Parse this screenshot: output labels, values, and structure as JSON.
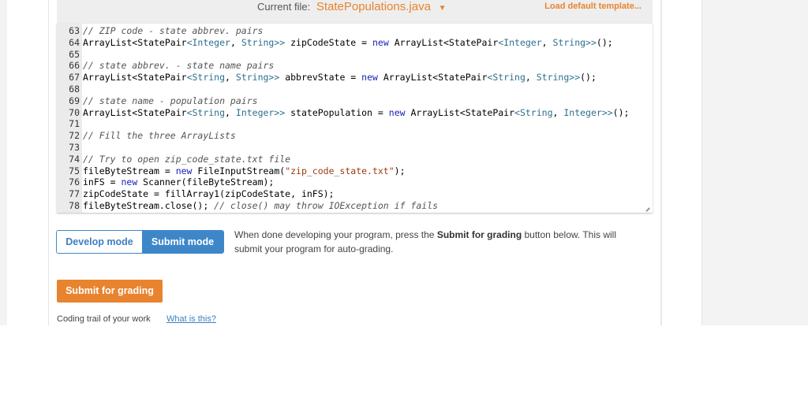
{
  "toolbar": {
    "current_file_label": "Current file:",
    "current_file_name": "StatePopulations.java",
    "load_default_template": "Load default template..."
  },
  "editor": {
    "lines": [
      {
        "n": "63",
        "parts": [
          {
            "t": "// ZIP code - state abbrev. pairs",
            "c": "cm"
          }
        ]
      },
      {
        "n": "64",
        "parts": [
          {
            "t": "ArrayList<StatePair",
            "c": "code"
          },
          {
            "t": "<Integer",
            "c": "ty"
          },
          {
            "t": ", ",
            "c": "code"
          },
          {
            "t": "String>>",
            "c": "ty"
          },
          {
            "t": " zipCodeState = ",
            "c": "code"
          },
          {
            "t": "new",
            "c": "kw"
          },
          {
            "t": " ArrayList<StatePair",
            "c": "code"
          },
          {
            "t": "<Integer",
            "c": "ty"
          },
          {
            "t": ", ",
            "c": "code"
          },
          {
            "t": "String>>",
            "c": "ty"
          },
          {
            "t": "();",
            "c": "code"
          }
        ]
      },
      {
        "n": "65",
        "parts": []
      },
      {
        "n": "66",
        "parts": [
          {
            "t": "// state abbrev. - state name pairs",
            "c": "cm"
          }
        ]
      },
      {
        "n": "67",
        "parts": [
          {
            "t": "ArrayList<StatePair",
            "c": "code"
          },
          {
            "t": "<String",
            "c": "ty"
          },
          {
            "t": ", ",
            "c": "code"
          },
          {
            "t": "String>>",
            "c": "ty"
          },
          {
            "t": " abbrevState = ",
            "c": "code"
          },
          {
            "t": "new",
            "c": "kw"
          },
          {
            "t": " ArrayList<StatePair",
            "c": "code"
          },
          {
            "t": "<String",
            "c": "ty"
          },
          {
            "t": ", ",
            "c": "code"
          },
          {
            "t": "String>>",
            "c": "ty"
          },
          {
            "t": "();",
            "c": "code"
          }
        ]
      },
      {
        "n": "68",
        "parts": []
      },
      {
        "n": "69",
        "parts": [
          {
            "t": "// state name - population pairs",
            "c": "cm"
          }
        ]
      },
      {
        "n": "70",
        "parts": [
          {
            "t": "ArrayList<StatePair",
            "c": "code"
          },
          {
            "t": "<String",
            "c": "ty"
          },
          {
            "t": ", ",
            "c": "code"
          },
          {
            "t": "Integer>>",
            "c": "ty"
          },
          {
            "t": " statePopulation = ",
            "c": "code"
          },
          {
            "t": "new",
            "c": "kw"
          },
          {
            "t": " ArrayList<StatePair",
            "c": "code"
          },
          {
            "t": "<String",
            "c": "ty"
          },
          {
            "t": ", ",
            "c": "code"
          },
          {
            "t": "Integer>>",
            "c": "ty"
          },
          {
            "t": "();",
            "c": "code"
          }
        ]
      },
      {
        "n": "71",
        "parts": []
      },
      {
        "n": "72",
        "parts": [
          {
            "t": "// Fill the three ArrayLists",
            "c": "cm"
          }
        ]
      },
      {
        "n": "73",
        "parts": []
      },
      {
        "n": "74",
        "parts": [
          {
            "t": "// Try to open zip_code_state.txt file",
            "c": "cm"
          }
        ]
      },
      {
        "n": "75",
        "parts": [
          {
            "t": "fileByteStream = ",
            "c": "code"
          },
          {
            "t": "new",
            "c": "kw"
          },
          {
            "t": " FileInputStream(",
            "c": "code"
          },
          {
            "t": "\"zip_code_state.txt\"",
            "c": "str"
          },
          {
            "t": ");",
            "c": "code"
          }
        ]
      },
      {
        "n": "76",
        "parts": [
          {
            "t": "inFS = ",
            "c": "code"
          },
          {
            "t": "new",
            "c": "kw"
          },
          {
            "t": " Scanner(fileByteStream);",
            "c": "code"
          }
        ]
      },
      {
        "n": "77",
        "parts": [
          {
            "t": "zipCodeState = fillArray1(zipCodeState, inFS);",
            "c": "code"
          }
        ]
      },
      {
        "n": "78",
        "parts": [
          {
            "t": "fileByteStream.close(); ",
            "c": "code"
          },
          {
            "t": "// close() may throw IOException if fails",
            "c": "cm"
          }
        ]
      }
    ]
  },
  "mode": {
    "develop_label": "Develop mode",
    "submit_label": "Submit mode",
    "active": "submit"
  },
  "description": {
    "before": "When done developing your program, press the ",
    "bold": "Submit for grading",
    "after": " button below. This will submit your program for auto-grading."
  },
  "submit_button": "Submit for grading",
  "coding_trail": {
    "label": "Coding trail of your work",
    "link": "What is this?"
  },
  "colors": {
    "accent_orange": "#e8842f",
    "accent_blue": "#3d87c9"
  }
}
